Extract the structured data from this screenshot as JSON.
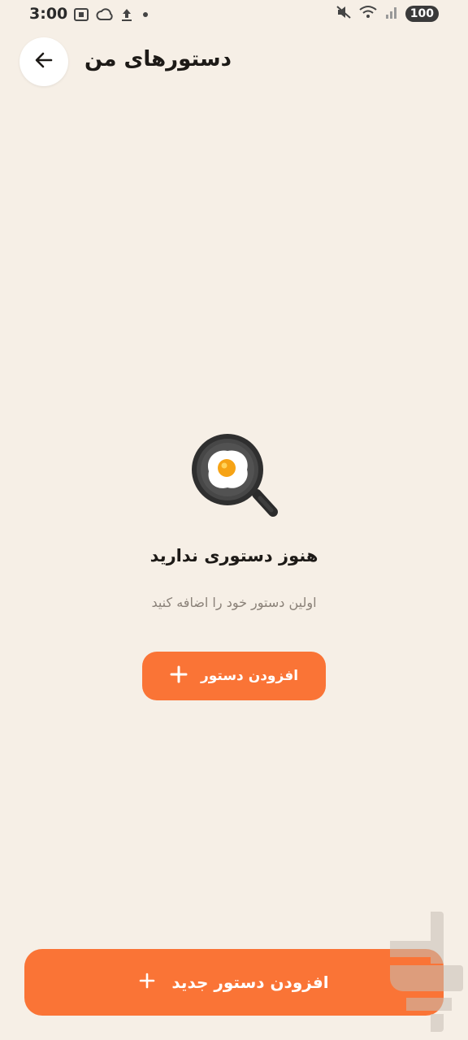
{
  "status_bar": {
    "time": "3:00",
    "battery": "100",
    "icons": [
      "screenshot-icon",
      "cloud-icon",
      "upload-icon",
      "dot-icon",
      "mute-icon",
      "wifi-icon",
      "signal-icon"
    ]
  },
  "header": {
    "title": "دستورهای من",
    "back_icon": "arrow-left-icon"
  },
  "empty_state": {
    "illustration": "frying-pan-egg-search-icon",
    "title": "هنوز دستوری ندارید",
    "subtitle": "اولین دستور خود را اضافه کنید",
    "button_label": "افزودن دستور"
  },
  "footer": {
    "button_label": "افزودن دستور جدید"
  },
  "colors": {
    "background": "#f6efe6",
    "accent": "#fa7436",
    "title": "#1d1a17",
    "subtitle": "#8a8178"
  }
}
